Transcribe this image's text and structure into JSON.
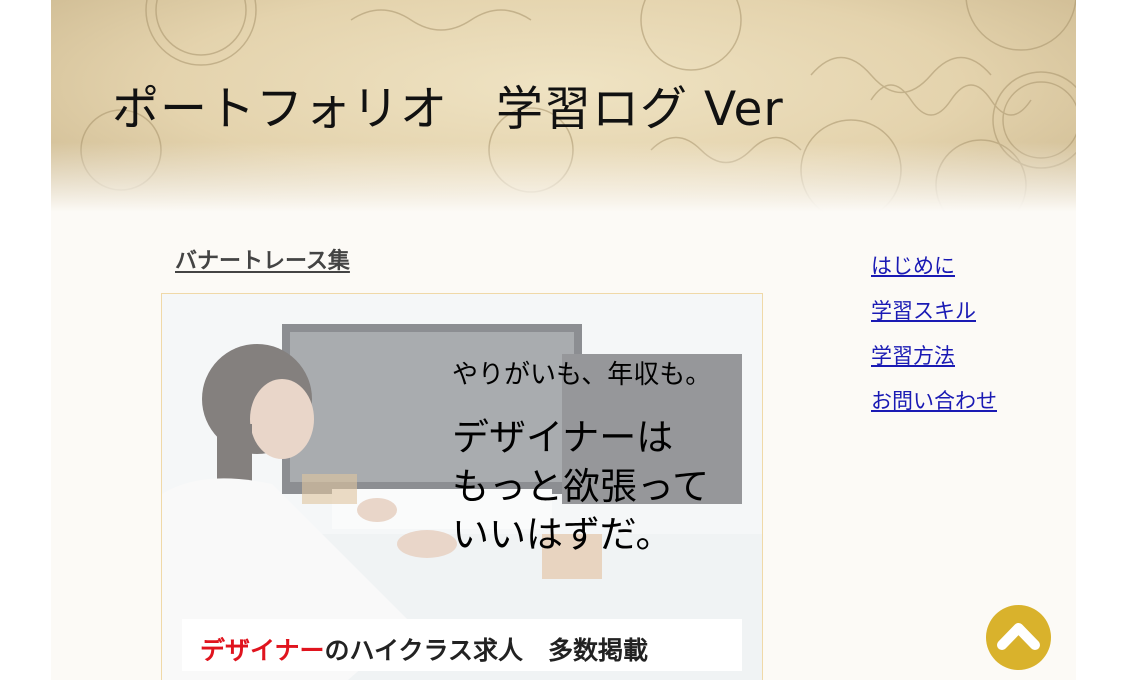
{
  "header": {
    "site_title": "ポートフォリオ　学習ログ Ver"
  },
  "main": {
    "section_title": "バナートレース集",
    "banner": {
      "tagline": "やりがいも、年収も。",
      "headline_lines": [
        "デザイナーは",
        "もっと欲張って",
        "いいはずだ。"
      ],
      "caption_red": "デザイナー",
      "caption_rest": "のハイクラス求人　多数掲載"
    }
  },
  "nav": {
    "items": [
      {
        "label": "はじめに"
      },
      {
        "label": "学習スキル"
      },
      {
        "label": "学習方法"
      },
      {
        "label": "お問い合わせ"
      }
    ]
  },
  "colors": {
    "link": "#1a1ab4",
    "top_button": "#d9b22c",
    "caption_accent": "#e0141e"
  },
  "icons": {
    "top_button": "chevron-up-icon"
  }
}
